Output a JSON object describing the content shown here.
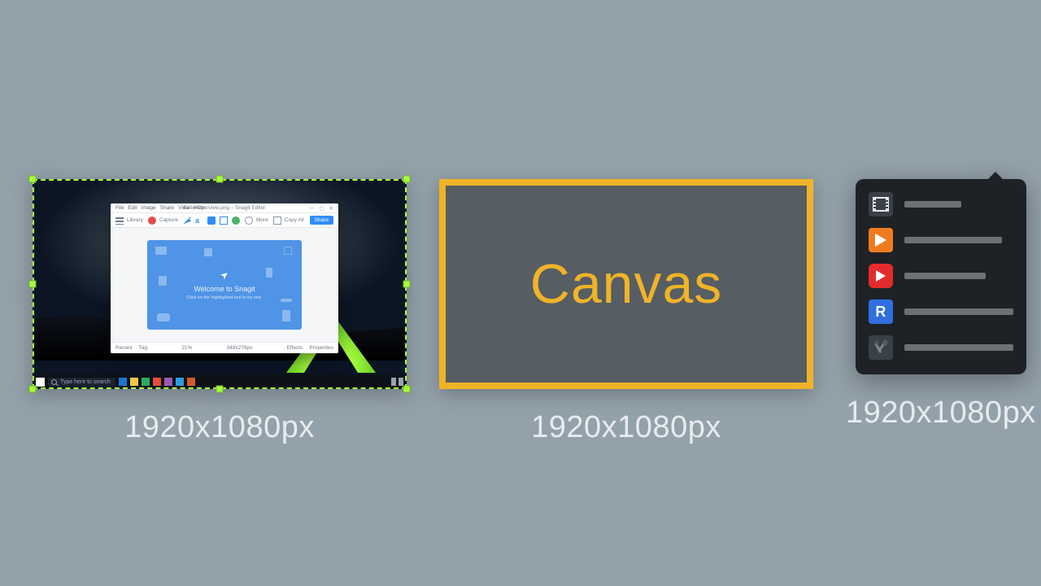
{
  "captions": {
    "panel1": "1920x1080px",
    "panel2": "1920x1080px",
    "panel3": "1920x1080px"
  },
  "canvas": {
    "label": "Canvas",
    "accent": "#f0b328"
  },
  "screenshot": {
    "selection_color": "#a8ff3e",
    "taskbar": {
      "search_placeholder": "Type here to search"
    },
    "editor": {
      "menus": [
        "File",
        "Edit",
        "Image",
        "Share",
        "View",
        "Help"
      ],
      "title": "EditorOverview.png – Snagit Editor",
      "toolbar": {
        "library": "Library",
        "capture": "Capture",
        "more": "More",
        "copy_all": "Copy All",
        "share": "Share"
      },
      "welcome": {
        "title": "Welcome to Snagit",
        "subtitle": "Click on the highlighted tool to try one."
      },
      "status": {
        "recent": "Recent",
        "tag": "Tag",
        "zoom": "21%",
        "size": "349x278px",
        "effects": "Effects",
        "properties": "Properties"
      }
    }
  },
  "menu": {
    "items": [
      {
        "name": "film-icon",
        "fill": "#3a4047",
        "sym": "film"
      },
      {
        "name": "play-icon",
        "fill": "#f07b1f",
        "sym": "play"
      },
      {
        "name": "youtube-icon",
        "fill": "#e42b2b",
        "sym": "play-rounded"
      },
      {
        "name": "relay-icon",
        "fill": "#2f6fe0",
        "sym": "R"
      },
      {
        "name": "tools-icon",
        "fill": "#3a4047",
        "sym": "tools"
      }
    ]
  }
}
